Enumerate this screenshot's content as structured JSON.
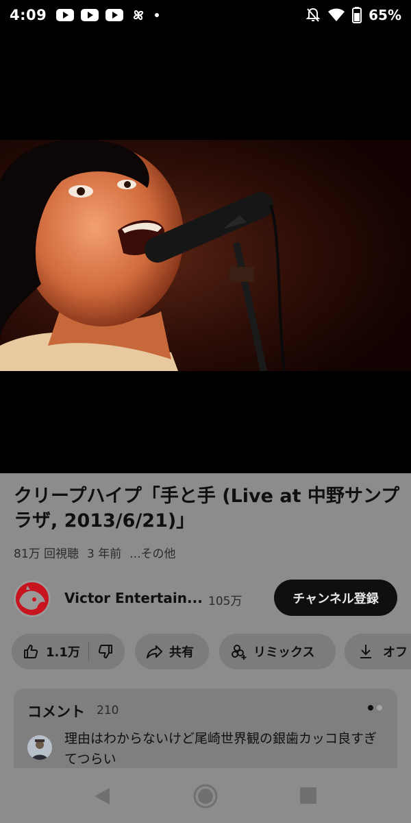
{
  "status_bar": {
    "time": "4:09",
    "battery": "65%",
    "icons": [
      "youtube-notification-icon",
      "youtube-notification-icon",
      "youtube-notification-icon",
      "pinwheel-icon",
      "dot-icon",
      "notifications-muted-icon",
      "wifi-icon",
      "battery-icon"
    ]
  },
  "video": {
    "title": "クリープハイプ「手と手 (Live at 中野サンプラザ, 2013/6/21)」",
    "views": "81万 回視聴",
    "age": "3 年前",
    "more": "...その他"
  },
  "channel": {
    "name": "Victor Entertain...",
    "subscribers": "105万",
    "subscribe_label": "チャンネル登録"
  },
  "actions": {
    "like_count": "1.1万",
    "share_label": "共有",
    "remix_label": "リミックス",
    "offline_label": "オフ"
  },
  "comments": {
    "title": "コメント",
    "count": "210",
    "top_comment": "理由はわからないけど尾崎世界観の銀歯カッコ良すぎてつらい"
  },
  "colors": {
    "dim_background": "#8c8c8c",
    "subscribe_button": "#0f0f0f",
    "channel_logo_red": "#c8141e"
  }
}
